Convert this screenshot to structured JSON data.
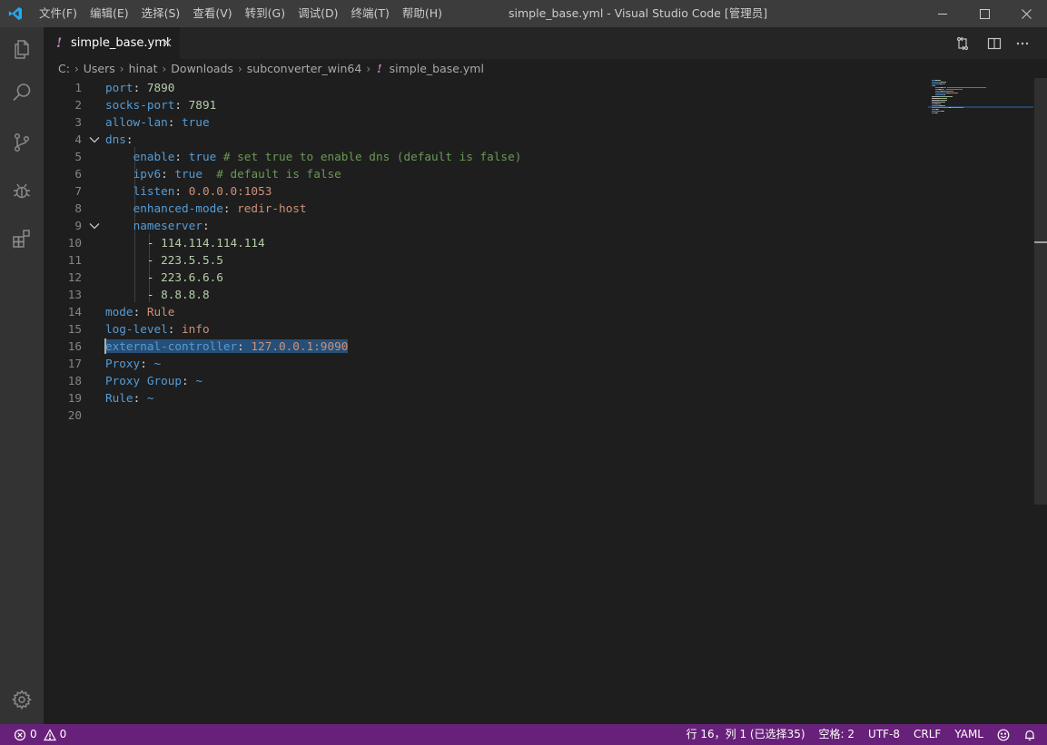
{
  "window": {
    "menu": [
      "文件(F)",
      "编辑(E)",
      "选择(S)",
      "查看(V)",
      "转到(G)",
      "调试(D)",
      "终端(T)",
      "帮助(H)"
    ],
    "title": "simple_base.yml - Visual Studio Code [管理员]"
  },
  "activity_bar": {
    "items": [
      "explorer-icon",
      "search-icon",
      "source-control-icon",
      "debug-icon",
      "extensions-icon"
    ],
    "bottom": "gear-icon"
  },
  "tab": {
    "label": "simple_base.yml",
    "icon": "yaml-file-icon",
    "icon_glyph": "!"
  },
  "breadcrumb": {
    "parts": [
      "C:",
      "Users",
      "hinat",
      "Downloads",
      "subconverter_win64"
    ],
    "file_icon_glyph": "!",
    "file": "simple_base.yml"
  },
  "colors": {
    "key": "#569cd6",
    "number": "#b5cea8",
    "string": "#ce9178",
    "comment": "#6a9955",
    "selection": "#264f78",
    "statusbar": "#68217a",
    "titlebar": "#3c3c3c",
    "activitybar": "#333333"
  },
  "code": {
    "lines": [
      {
        "n": "1",
        "tokens": [
          {
            "t": "k",
            "v": "port"
          },
          {
            "t": "p",
            "v": ": "
          },
          {
            "t": "n",
            "v": "7890"
          }
        ]
      },
      {
        "n": "2",
        "tokens": [
          {
            "t": "k",
            "v": "socks-port"
          },
          {
            "t": "p",
            "v": ": "
          },
          {
            "t": "n",
            "v": "7891"
          }
        ]
      },
      {
        "n": "3",
        "tokens": [
          {
            "t": "k",
            "v": "allow-lan"
          },
          {
            "t": "p",
            "v": ": "
          },
          {
            "t": "b",
            "v": "true"
          }
        ]
      },
      {
        "n": "4",
        "fold": true,
        "tokens": [
          {
            "t": "k",
            "v": "dns"
          },
          {
            "t": "p",
            "v": ":"
          }
        ]
      },
      {
        "n": "5",
        "tokens": [
          {
            "t": "p",
            "v": "    "
          },
          {
            "t": "k",
            "v": "enable"
          },
          {
            "t": "p",
            "v": ": "
          },
          {
            "t": "b",
            "v": "true"
          },
          {
            "t": "p",
            "v": " "
          },
          {
            "t": "c",
            "v": "# set true to enable dns (default is false)"
          }
        ]
      },
      {
        "n": "6",
        "tokens": [
          {
            "t": "p",
            "v": "    "
          },
          {
            "t": "k",
            "v": "ipv6"
          },
          {
            "t": "p",
            "v": ": "
          },
          {
            "t": "b",
            "v": "true"
          },
          {
            "t": "p",
            "v": "  "
          },
          {
            "t": "c",
            "v": "# default is false"
          }
        ]
      },
      {
        "n": "7",
        "tokens": [
          {
            "t": "p",
            "v": "    "
          },
          {
            "t": "k",
            "v": "listen"
          },
          {
            "t": "p",
            "v": ": "
          },
          {
            "t": "s",
            "v": "0.0.0.0:1053"
          }
        ]
      },
      {
        "n": "8",
        "tokens": [
          {
            "t": "p",
            "v": "    "
          },
          {
            "t": "k",
            "v": "enhanced-mode"
          },
          {
            "t": "p",
            "v": ": "
          },
          {
            "t": "s",
            "v": "redir-host"
          }
        ]
      },
      {
        "n": "9",
        "fold": true,
        "tokens": [
          {
            "t": "p",
            "v": "    "
          },
          {
            "t": "k",
            "v": "nameserver"
          },
          {
            "t": "p",
            "v": ":"
          }
        ]
      },
      {
        "n": "10",
        "tokens": [
          {
            "t": "p",
            "v": "      - "
          },
          {
            "t": "n",
            "v": "114.114.114.114"
          }
        ]
      },
      {
        "n": "11",
        "tokens": [
          {
            "t": "p",
            "v": "      - "
          },
          {
            "t": "n",
            "v": "223.5.5.5"
          }
        ]
      },
      {
        "n": "12",
        "tokens": [
          {
            "t": "p",
            "v": "      - "
          },
          {
            "t": "n",
            "v": "223.6.6.6"
          }
        ]
      },
      {
        "n": "13",
        "tokens": [
          {
            "t": "p",
            "v": "      - "
          },
          {
            "t": "n",
            "v": "8.8.8.8"
          }
        ]
      },
      {
        "n": "14",
        "tokens": [
          {
            "t": "k",
            "v": "mode"
          },
          {
            "t": "p",
            "v": ": "
          },
          {
            "t": "s",
            "v": "Rule"
          }
        ]
      },
      {
        "n": "15",
        "tokens": [
          {
            "t": "k",
            "v": "log-level"
          },
          {
            "t": "p",
            "v": ": "
          },
          {
            "t": "s",
            "v": "info"
          }
        ]
      },
      {
        "n": "16",
        "selected": true,
        "tokens": [
          {
            "t": "k",
            "v": "external-controller"
          },
          {
            "t": "p",
            "v": ": "
          },
          {
            "t": "s",
            "v": "127.0.0.1:9090"
          }
        ]
      },
      {
        "n": "17",
        "tokens": [
          {
            "t": "k",
            "v": "Proxy"
          },
          {
            "t": "p",
            "v": ": "
          },
          {
            "t": "k",
            "v": "~"
          }
        ]
      },
      {
        "n": "18",
        "tokens": [
          {
            "t": "k",
            "v": "Proxy Group"
          },
          {
            "t": "p",
            "v": ": "
          },
          {
            "t": "k",
            "v": "~"
          }
        ]
      },
      {
        "n": "19",
        "tokens": [
          {
            "t": "k",
            "v": "Rule"
          },
          {
            "t": "p",
            "v": ": "
          },
          {
            "t": "k",
            "v": "~"
          }
        ]
      },
      {
        "n": "20",
        "tokens": []
      }
    ]
  },
  "status_bar": {
    "errors": "0",
    "warnings": "0",
    "cursor_position": "行 16，列 1 (已选择35)",
    "indentation": "空格: 2",
    "encoding": "UTF-8",
    "eol": "CRLF",
    "language": "YAML"
  }
}
